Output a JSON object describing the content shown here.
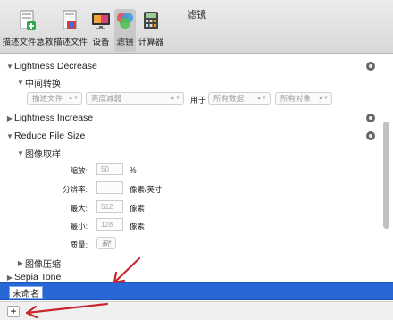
{
  "window": {
    "title": "滤镜"
  },
  "toolbar": {
    "items": [
      {
        "label": "描述文件急救"
      },
      {
        "label": "描述文件"
      },
      {
        "label": "设备"
      },
      {
        "label": "滤镜"
      },
      {
        "label": "计算器"
      }
    ]
  },
  "filters": {
    "lightness_decrease": {
      "title": "Lightness Decrease",
      "sub_title": "中间转换",
      "select1": "描述文件",
      "select2": "亮度减弱",
      "for_label": "用于",
      "select3": "所有数据",
      "select4": "所有对象"
    },
    "lightness_increase": {
      "title": "Lightness Increase"
    },
    "reduce_file_size": {
      "title": "Reduce File Size",
      "image_sampling": "图像取样",
      "scale_label": "缩放:",
      "scale_value": "50",
      "scale_unit": "%",
      "resolution_label": "分辨率:",
      "resolution_value": "",
      "resolution_unit": "像素/英寸",
      "max_label": "最大:",
      "max_value": "512",
      "max_unit": "像素",
      "min_label": "最小:",
      "min_value": "128",
      "min_unit": "像素",
      "quality_label": "质量:",
      "quality_value": "高",
      "image_compression": "图像压缩"
    },
    "sepia_tone": {
      "title": "Sepia Tone"
    }
  },
  "name_field": {
    "value": "未命名"
  },
  "bottom_bar": {
    "add_label": "+"
  },
  "colors": {
    "selection": "#2868d6",
    "arrow": "#c8282e"
  }
}
